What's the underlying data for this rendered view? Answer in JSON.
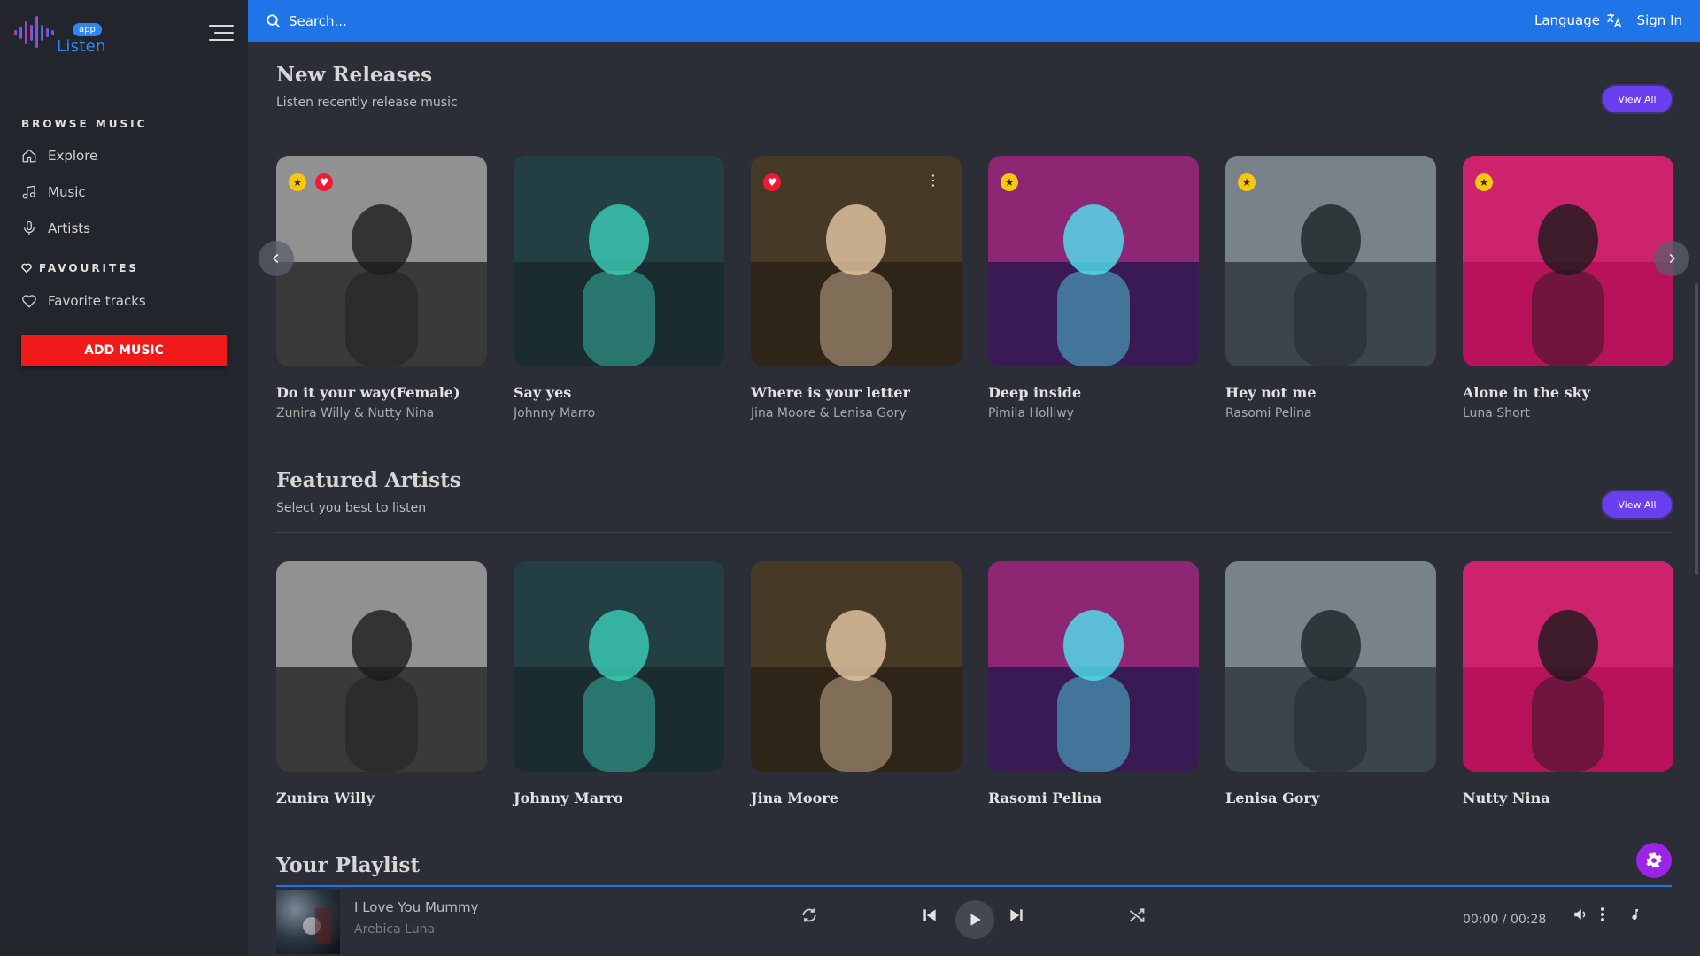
{
  "app": {
    "logo_text": "Listen",
    "logo_badge": "app"
  },
  "sidebar": {
    "browse_heading": "BROWSE MUSIC",
    "items": [
      {
        "label": "Explore",
        "icon": "home-icon"
      },
      {
        "label": "Music",
        "icon": "music-note-icon"
      },
      {
        "label": "Artists",
        "icon": "microphone-icon"
      }
    ],
    "favourites_heading": "FAVOURITES",
    "favourite_items": [
      {
        "label": "Favorite tracks",
        "icon": "heart-outline-icon"
      }
    ],
    "add_button": "ADD MUSIC"
  },
  "topbar": {
    "search_placeholder": "Search...",
    "language": "Language",
    "sign_in": "Sign In"
  },
  "new_releases": {
    "title": "New Releases",
    "subtitle": "Listen recently release music",
    "view_all": "View All",
    "cards": [
      {
        "title": "Do it your way(Female)",
        "artist": "Zunira Willy & Nutty Nina",
        "star": true,
        "heart": true,
        "menu": false
      },
      {
        "title": "Say yes",
        "artist": "Johnny Marro",
        "star": false,
        "heart": false,
        "menu": false
      },
      {
        "title": "Where is your letter",
        "artist": "Jina Moore & Lenisa Gory",
        "star": false,
        "heart": true,
        "menu": true
      },
      {
        "title": "Deep inside",
        "artist": "Pimila Holliwy",
        "star": true,
        "heart": false,
        "menu": false
      },
      {
        "title": "Hey not me",
        "artist": "Rasomi Pelina",
        "star": true,
        "heart": false,
        "menu": false
      },
      {
        "title": "Alone in the sky",
        "artist": "Luna Short",
        "star": true,
        "heart": false,
        "menu": false
      }
    ]
  },
  "featured_artists": {
    "title": "Featured Artists",
    "subtitle": "Select you best to listen",
    "view_all": "View All",
    "artists": [
      "Zunira Willy",
      "Johnny Marro",
      "Jina Moore",
      "Rasomi Pelina",
      "Lenisa Gory",
      "Nutty Nina"
    ]
  },
  "playlist": {
    "title": "Your Playlist"
  },
  "player": {
    "track_title": "I Love You Mummy",
    "track_artist": "Arebica Luna",
    "time": "00:00 / 00:28"
  },
  "colors": {
    "accent_blue": "#1f74e8",
    "add_red": "#f01a1a",
    "view_all_purple": "#6a3ff0",
    "fab_purple": "#9b24e6"
  }
}
